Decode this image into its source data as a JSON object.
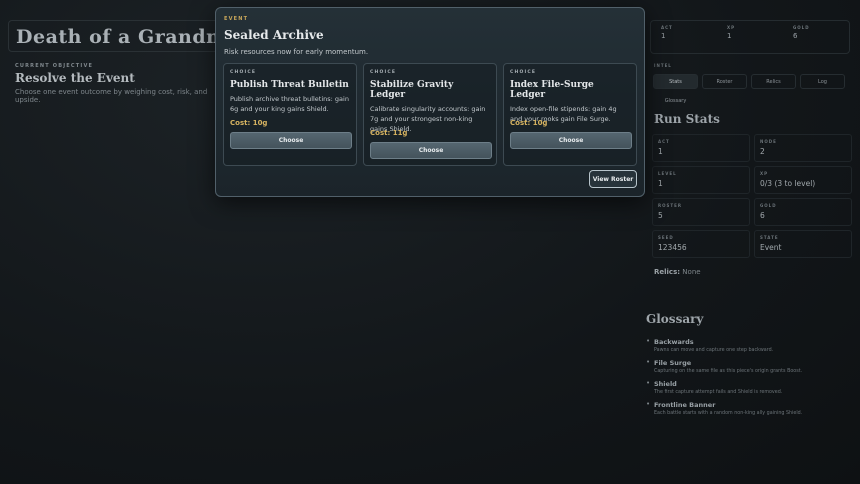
{
  "game_title": "Death of a Grandmaster",
  "objective": {
    "kicker": "CURRENT OBJECTIVE",
    "title": "Resolve the Event",
    "subtitle": "Choose one event outcome by weighing cost, risk, and upside."
  },
  "top_stats": [
    {
      "label": "ACT",
      "value": "1"
    },
    {
      "label": "XP",
      "value": "1"
    },
    {
      "label": "GOLD",
      "value": "6"
    }
  ],
  "intel_label": "INTEL",
  "tabs": [
    "Stats",
    "Roster",
    "Relics",
    "Log",
    "Glossary"
  ],
  "run_stats": {
    "title": "Run Stats",
    "cells": [
      {
        "label": "ACT",
        "value": "1"
      },
      {
        "label": "NODE",
        "value": "2"
      },
      {
        "label": "LEVEL",
        "value": "1"
      },
      {
        "label": "XP",
        "value": "0/3 (3 to level)"
      },
      {
        "label": "ROSTER",
        "value": "5"
      },
      {
        "label": "GOLD",
        "value": "6"
      },
      {
        "label": "SEED",
        "value": "123456"
      },
      {
        "label": "STATE",
        "value": "Event"
      }
    ],
    "relics_label": "Relics:",
    "relics_value": "None"
  },
  "glossary": {
    "title": "Glossary",
    "items": [
      {
        "term": "Backwards",
        "def": "Pawns can move and capture one step backward."
      },
      {
        "term": "File Surge",
        "def": "Capturing on the same file as this piece's origin grants Boost."
      },
      {
        "term": "Shield",
        "def": "The first capture attempt fails and Shield is removed."
      },
      {
        "term": "Frontline Banner",
        "def": "Each battle starts with a random non-king ally gaining Shield."
      }
    ]
  },
  "modal": {
    "kicker": "EVENT",
    "title": "Sealed Archive",
    "subtitle": "Risk resources now for early momentum.",
    "choices": [
      {
        "kicker": "CHOICE",
        "title": "Publish Threat Bulletin",
        "desc": "Publish archive threat bulletins: gain 6g and your king gains Shield.",
        "cost": "Cost: 10g",
        "button": "Choose"
      },
      {
        "kicker": "CHOICE",
        "title": "Stabilize Gravity Ledger",
        "desc": "Calibrate singularity accounts: gain 7g and your strongest non-king gains Shield.",
        "cost": "Cost: 11g",
        "button": "Choose"
      },
      {
        "kicker": "CHOICE",
        "title": "Index File-Surge Ledger",
        "desc": "Index open-file stipends: gain 4g and your rooks gain File Surge.",
        "cost": "Cost: 10g",
        "button": "Choose"
      }
    ],
    "view_roster": "View Roster"
  }
}
